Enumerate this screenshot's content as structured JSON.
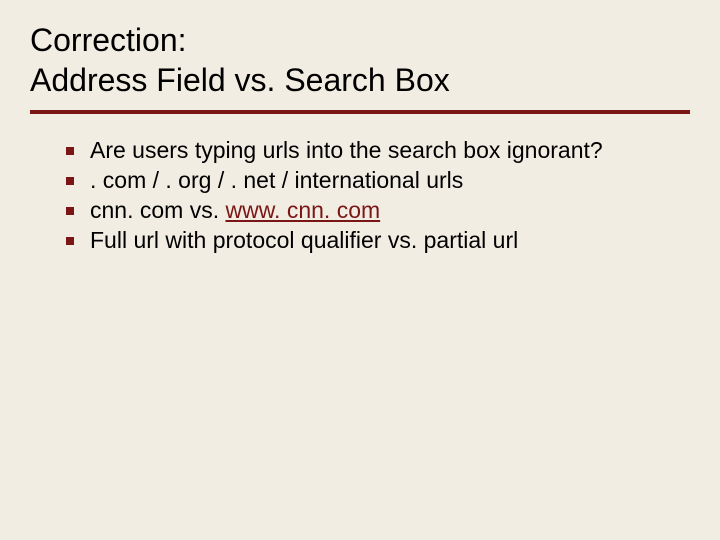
{
  "title_line1": "Correction:",
  "title_line2": "Address Field vs. Search Box",
  "bullets": [
    {
      "text": "Are users typing urls into the search box ignorant?"
    },
    {
      "text": ". com / . org / . net / international urls"
    },
    {
      "pre": "cnn. com vs. ",
      "link": "www. cnn. com"
    },
    {
      "text": "Full url with protocol qualifier vs. partial url"
    }
  ]
}
